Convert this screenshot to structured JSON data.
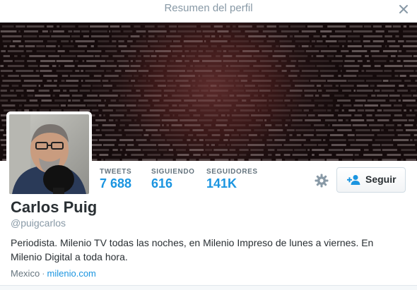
{
  "modal": {
    "title": "Resumen del perfil",
    "close_icon": "close-icon"
  },
  "profile": {
    "name": "Carlos Puig",
    "handle": "@puigcarlos",
    "bio": "Periodista. Milenio TV todas las noches, en Milenio Impreso de lunes a viernes. En Milenio Digital a toda hora.",
    "location": "Mexico",
    "separator": "·",
    "website": "milenio.com"
  },
  "stats": {
    "tweets": {
      "label": "TWEETS",
      "value": "7 688"
    },
    "following": {
      "label": "SIGUIENDO",
      "value": "616"
    },
    "followers": {
      "label": "SEGUIDORES",
      "value": "141K"
    }
  },
  "actions": {
    "settings_icon": "gear-icon",
    "follow_icon": "add-user-icon",
    "follow_label": "Seguir"
  },
  "colors": {
    "accent": "#1b95e0",
    "text": "#292f33",
    "muted": "#8899a6",
    "banner": "#3a1818"
  }
}
